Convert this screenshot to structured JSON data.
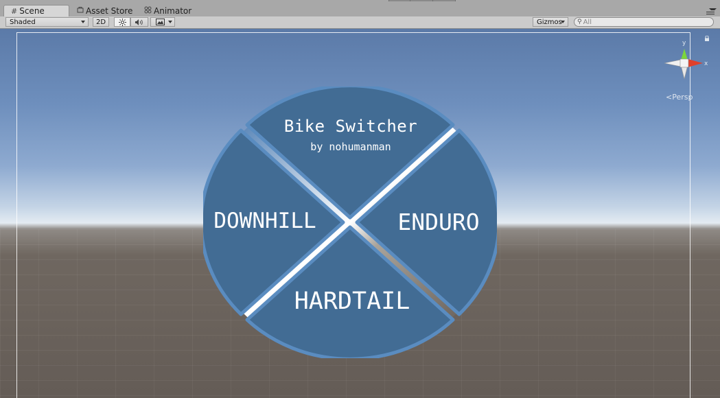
{
  "tabs": [
    {
      "label": "Scene",
      "icon": "grid-icon",
      "active": true
    },
    {
      "label": "Asset Store",
      "icon": "store-icon",
      "active": false
    },
    {
      "label": "Animator",
      "icon": "animator-icon",
      "active": false
    }
  ],
  "toolbar": {
    "shading_mode": "Shaded",
    "mode_2d": "2D",
    "lighting_icon": "sun-icon",
    "audio_icon": "speaker-icon",
    "effects_icon": "image-icon",
    "gizmos_label": "Gizmos",
    "search": {
      "placeholder": "All",
      "value": ""
    }
  },
  "scene": {
    "projection_label": "Persp",
    "gizmo_axes": {
      "y": "y",
      "x": "x"
    },
    "colors": {
      "panel_fill": "#426c94",
      "panel_border": "#5a8cc0",
      "y_axis": "#7cd63a",
      "x_axis": "#e0402a"
    }
  },
  "ui": {
    "title": "Bike Switcher",
    "author": "by nohumanman",
    "buttons": {
      "downhill": "DOWNHILL",
      "enduro": "ENDURO",
      "hardtail": "HARDTAIL"
    }
  }
}
